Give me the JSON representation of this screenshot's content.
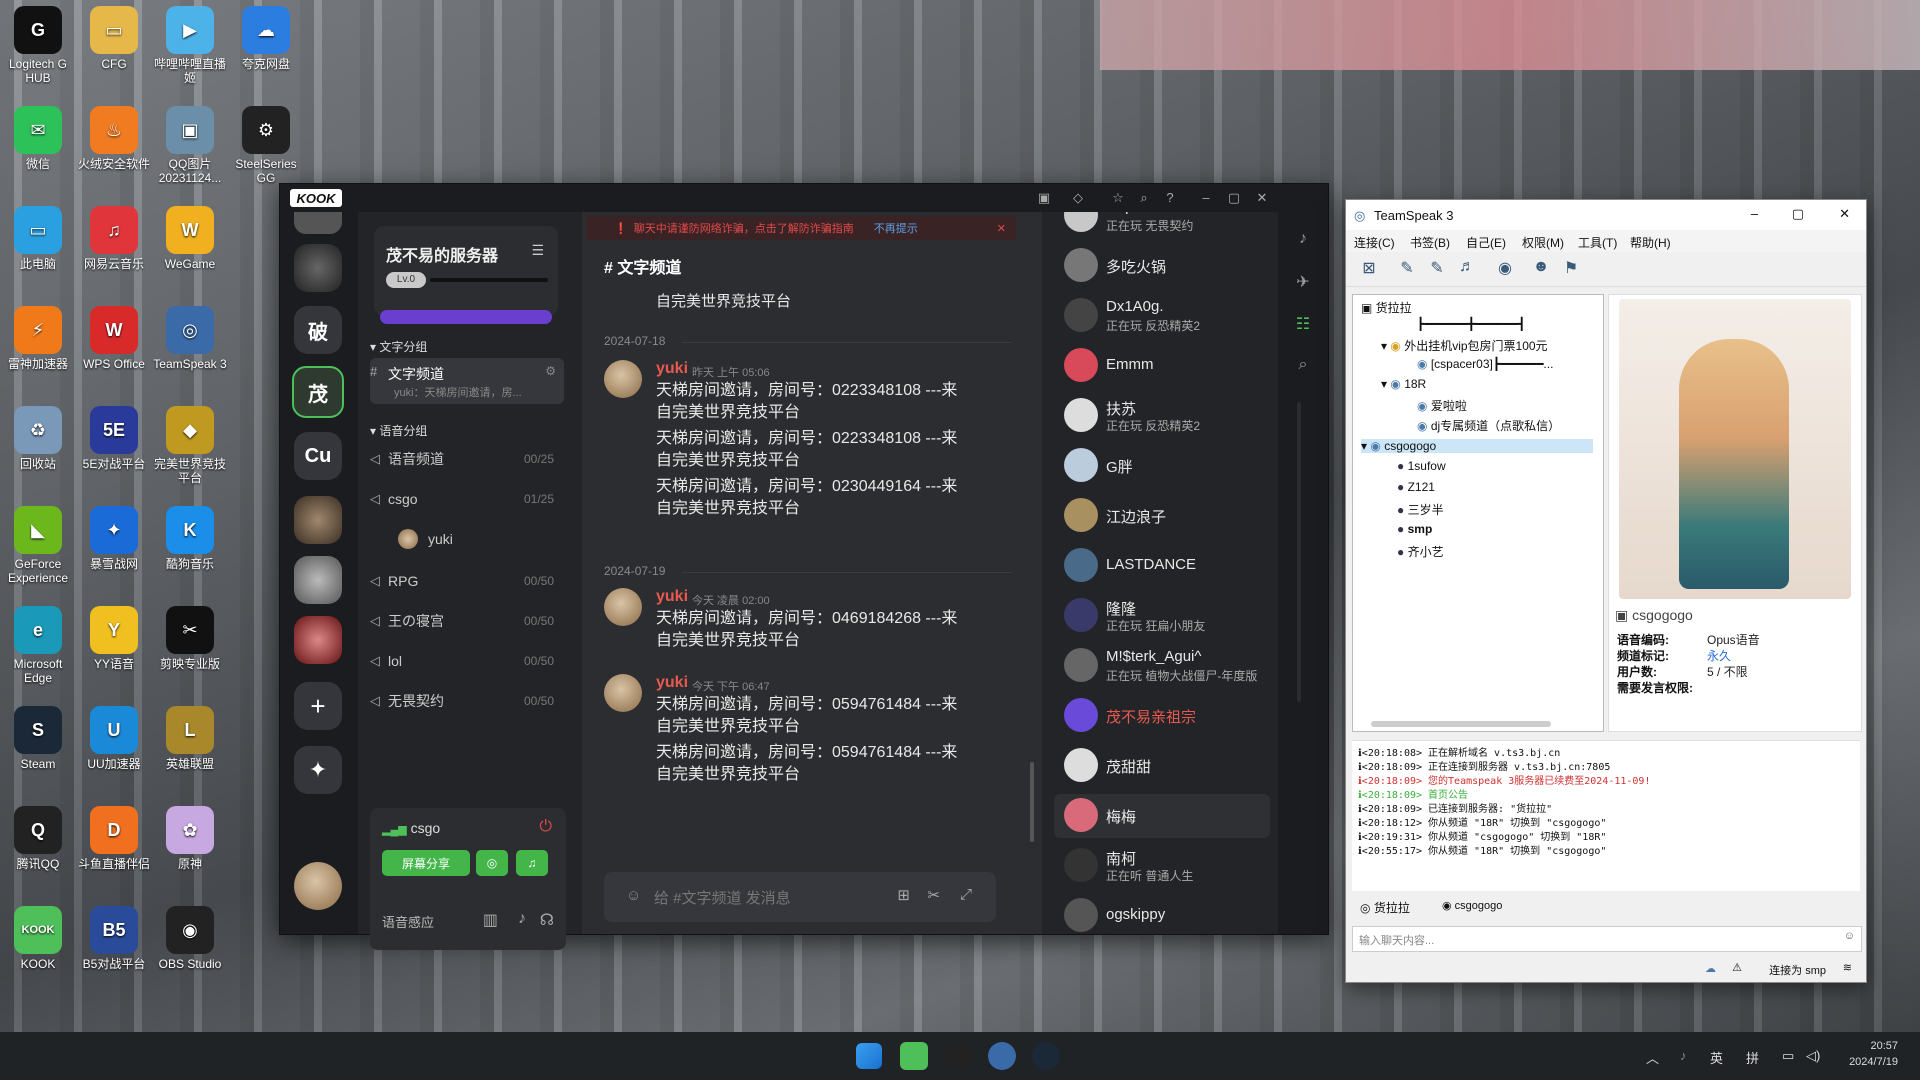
{
  "desktop": {
    "icons": [
      {
        "label": "Logitech G HUB",
        "glyph": "G",
        "color": "#111111"
      },
      {
        "label": "CFG",
        "glyph": "▭",
        "color": "#e6b84a"
      },
      {
        "label": "哔哩哔哩直播姬",
        "glyph": "▶",
        "color": "#4cb2e8"
      },
      {
        "label": "夸克网盘",
        "glyph": "☁",
        "color": "#2c7de0"
      },
      {
        "label": "微信",
        "glyph": "✉",
        "color": "#2dc15a"
      },
      {
        "label": "火绒安全软件",
        "glyph": "♨",
        "color": "#f07b20"
      },
      {
        "label": "QQ图片20231124...",
        "glyph": "▣",
        "color": "#6b8fa8"
      },
      {
        "label": "SteelSeries GG",
        "glyph": "⚙",
        "color": "#222222"
      },
      {
        "label": "此电脑",
        "glyph": "▭",
        "color": "#2aa0e0"
      },
      {
        "label": "网易云音乐",
        "glyph": "♫",
        "color": "#e0353a"
      },
      {
        "label": "WeGame",
        "glyph": "W",
        "color": "#f0b020"
      },
      {
        "label": "雷神加速器",
        "glyph": "⚡",
        "color": "#f07a1a"
      },
      {
        "label": "WPS Office",
        "glyph": "W",
        "color": "#d92a2a"
      },
      {
        "label": "TeamSpeak 3",
        "glyph": "◎",
        "color": "#3a6aa8"
      },
      {
        "label": "回收站",
        "glyph": "♻",
        "color": "#7a98b8"
      },
      {
        "label": "5E对战平台",
        "glyph": "5E",
        "color": "#2a3a9a"
      },
      {
        "label": "完美世界竞技平台",
        "glyph": "◆",
        "color": "#c09a20"
      },
      {
        "label": "GeForce Experience",
        "glyph": "◣",
        "color": "#6cb81c"
      },
      {
        "label": "暴雪战网",
        "glyph": "✦",
        "color": "#1a6ad8"
      },
      {
        "label": "酷狗音乐",
        "glyph": "K",
        "color": "#1a8ee8"
      },
      {
        "label": "Microsoft Edge",
        "glyph": "e",
        "color": "#1a9ab8"
      },
      {
        "label": "YY语音",
        "glyph": "Y",
        "color": "#f0c020"
      },
      {
        "label": "剪映专业版",
        "glyph": "✂",
        "color": "#111111"
      },
      {
        "label": "Steam",
        "glyph": "S",
        "color": "#1b2838"
      },
      {
        "label": "UU加速器",
        "glyph": "U",
        "color": "#1a8ad8"
      },
      {
        "label": "英雄联盟",
        "glyph": "L",
        "color": "#a8882a"
      },
      {
        "label": "腾讯QQ",
        "glyph": "Q",
        "color": "#222222"
      },
      {
        "label": "斗鱼直播伴侣",
        "glyph": "D",
        "color": "#f07020"
      },
      {
        "label": "原神",
        "glyph": "✿",
        "color": "#c8a8e0"
      },
      {
        "label": "KOOK",
        "glyph": "KOOK",
        "color": "#4fbf5a"
      },
      {
        "label": "B5对战平台",
        "glyph": "B5",
        "color": "#2a4a9a"
      },
      {
        "label": "OBS Studio",
        "glyph": "◉",
        "color": "#222222"
      }
    ]
  },
  "kook": {
    "logo": "KOOK",
    "servers": [
      {
        "label": "破"
      },
      {
        "label": "茂"
      },
      {
        "label": "Cu"
      }
    ],
    "server_card": {
      "name": "茂不易的服务器",
      "level": "Lv.0"
    },
    "text_group": "文字分组",
    "voice_group": "语音分组",
    "text_channel": {
      "name": "文字频道",
      "preview": "yuki：天梯房间邀请，房..."
    },
    "voice_channels": [
      {
        "name": "语音频道",
        "count": "00/25"
      },
      {
        "name": "csgo",
        "count": "01/25"
      },
      {
        "name": "RPG",
        "count": "00/50"
      },
      {
        "name": "王の寝宫",
        "count": "00/50"
      },
      {
        "name": "lol",
        "count": "00/50"
      },
      {
        "name": "无畏契约",
        "count": "00/50"
      }
    ],
    "voice_member": "yuki",
    "voice_panel": {
      "channel": "csgo",
      "share": "屏幕分享",
      "sensitivity": "语音感应"
    },
    "warning": {
      "text": "聊天中请谨防网络诈骗，点击了解防诈骗指南",
      "dismiss": "不再提示"
    },
    "chat_title": "文字频道",
    "chat_top_line": "自完美世界竞技平台",
    "date1": "2024-07-18",
    "date2": "2024-07-19",
    "messages": [
      {
        "user": "yuki",
        "time": "昨天 上午 05:06",
        "lines": [
          "天梯房间邀请，房间号：0223348108 ---来",
          "自完美世界竞技平台",
          "天梯房间邀请，房间号：0223348108 ---来",
          "自完美世界竞技平台",
          "天梯房间邀请，房间号：0230449164 ---来",
          "自完美世界竞技平台"
        ]
      },
      {
        "user": "yuki",
        "time": "今天 凌晨 02:00",
        "lines": [
          "天梯房间邀请，房间号：0469184268 ---来",
          "自完美世界竞技平台"
        ]
      },
      {
        "user": "yuki",
        "time": "今天 下午 06:47",
        "lines": [
          "天梯房间邀请，房间号：0594761484 ---来",
          "自完美世界竞技平台",
          "天梯房间邀请，房间号：0594761484 ---来",
          "自完美世界竞技平台"
        ]
      }
    ],
    "input_placeholder": "给 #文字频道 发消息",
    "members": [
      {
        "name": "Cup",
        "status": "正在玩 无畏契约",
        "color": "#e8e8e8"
      },
      {
        "name": "多吃火锅",
        "status": "",
        "color": "#e8e8e8"
      },
      {
        "name": "Dx1A0g.",
        "status": "正在玩 反恐精英2",
        "color": "#e8e8e8"
      },
      {
        "name": "Emmm",
        "status": "",
        "color": "#e8e8e8"
      },
      {
        "name": "扶苏",
        "status": "正在玩 反恐精英2",
        "color": "#e8e8e8"
      },
      {
        "name": "G胖",
        "status": "",
        "color": "#e8e8e8"
      },
      {
        "name": "江边浪子",
        "status": "",
        "color": "#e8e8e8"
      },
      {
        "name": "LASTDANCE",
        "status": "",
        "color": "#e8e8e8"
      },
      {
        "name": "隆隆",
        "status": "正在玩 狂扁小朋友",
        "color": "#e8e8e8"
      },
      {
        "name": "M!$terk_Agui^",
        "status": "正在玩 植物大战僵尸-年度版",
        "color": "#e8e8e8"
      },
      {
        "name": "茂不易亲祖宗",
        "status": "",
        "color": "#e85a4f"
      },
      {
        "name": "茂甜甜",
        "status": "",
        "color": "#e8e8e8"
      },
      {
        "name": "梅梅",
        "status": "",
        "color": "#e8e8e8"
      },
      {
        "name": "南柯",
        "status": "正在听 普通人生",
        "color": "#e8e8e8"
      },
      {
        "name": "ogskippy",
        "status": "",
        "color": "#e8e8e8"
      }
    ]
  },
  "teamspeak": {
    "title": "TeamSpeak 3",
    "menu": [
      "连接(C)",
      "书签(B)",
      "自己(E)",
      "权限(M)",
      "工具(T)",
      "帮助(H)"
    ],
    "tree": {
      "server": "货拉拉",
      "spacer": "┣━━━━━━╋━━━━━━┫",
      "ch1": "外出挂机vip包房门票100元",
      "ch1_sub": "[cspacer03]┣━━━━━━...",
      "ch2": "18R",
      "ch2_sub1": "爱啦啦",
      "ch2_sub2": "dj专属频道（点歌私信）",
      "ch3": "csgogogo",
      "users": [
        "1sufow",
        "Z121",
        "三岁半",
        "smp",
        "齐小艺"
      ]
    },
    "info": {
      "channel": "csgogogo",
      "rows": [
        {
          "k": "语音编码:",
          "v": "Opus语音"
        },
        {
          "k": "频道标记:",
          "v": "永久"
        },
        {
          "k": "用户数:",
          "v": "5 / 不限"
        },
        {
          "k": "需要发言权限:",
          "v": ""
        }
      ]
    },
    "log": [
      "<20:18:08> 正在解析域名 v.ts3.bj.cn",
      "<20:18:09> 正在连接到服务器 v.ts3.bj.cn:7805",
      "<20:18:09> 您的Teamspeak 3服务器已续费至2024-11-09!",
      "<20:18:09> 首页公告",
      "<20:18:09> 已连接到服务器: \"货拉拉\"",
      "<20:18:12> 你从频道 \"18R\" 切换到 \"csgogogo\"",
      "<20:19:31> 你从频道 \"csgogogo\" 切换到 \"18R\"",
      "<20:55:17> 你从频道 \"18R\" 切换到 \"csgogogo\""
    ],
    "tabs": [
      "货拉拉",
      "csgogogo"
    ],
    "input_placeholder": "输入聊天内容...",
    "status": "连接为 smp"
  },
  "taskbar": {
    "ime1": "英",
    "ime2": "拼",
    "time": "20:57",
    "date": "2024/7/19"
  }
}
